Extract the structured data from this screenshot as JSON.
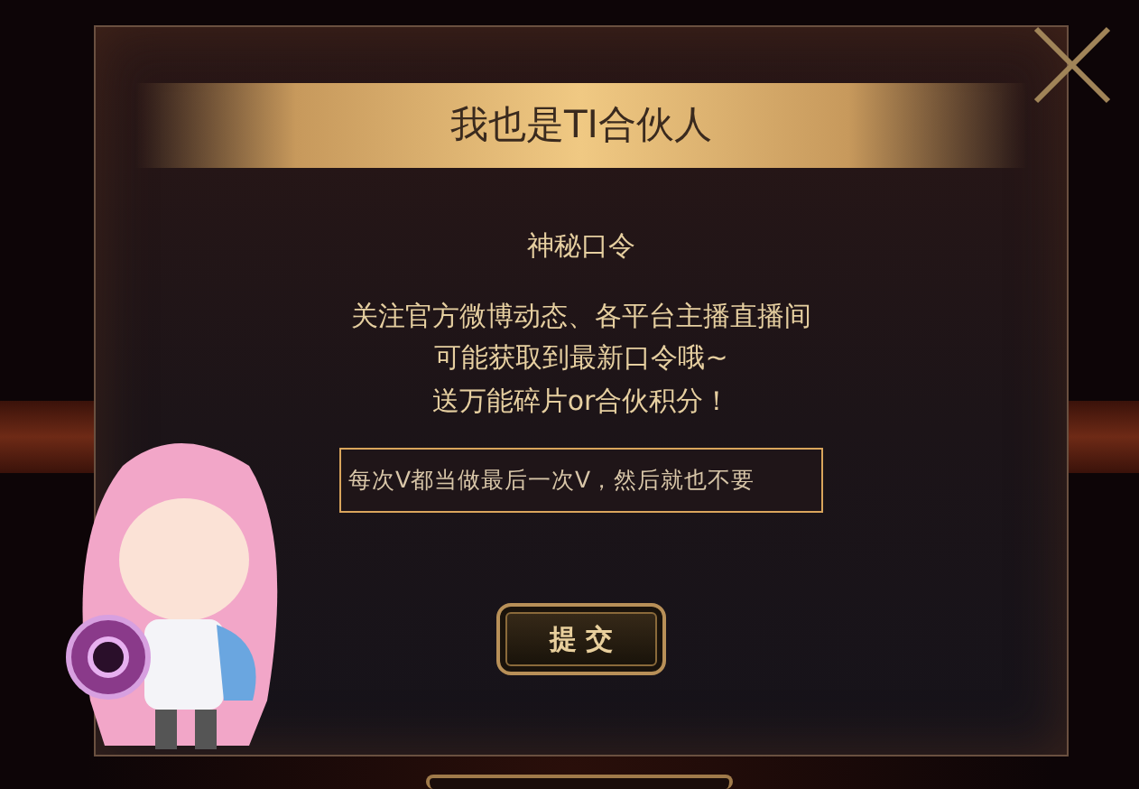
{
  "dialog": {
    "title": "我也是TI合伙人",
    "subtitle": "神秘口令",
    "description_lines": [
      "关注官方微博动态、各平台主播直播间",
      "可能获取到最新口令哦~",
      "送万能碎片or合伙积分！"
    ],
    "input": {
      "value": "每次V都当做最后一次V，然后就也不要"
    },
    "submit_button": "提 交"
  }
}
